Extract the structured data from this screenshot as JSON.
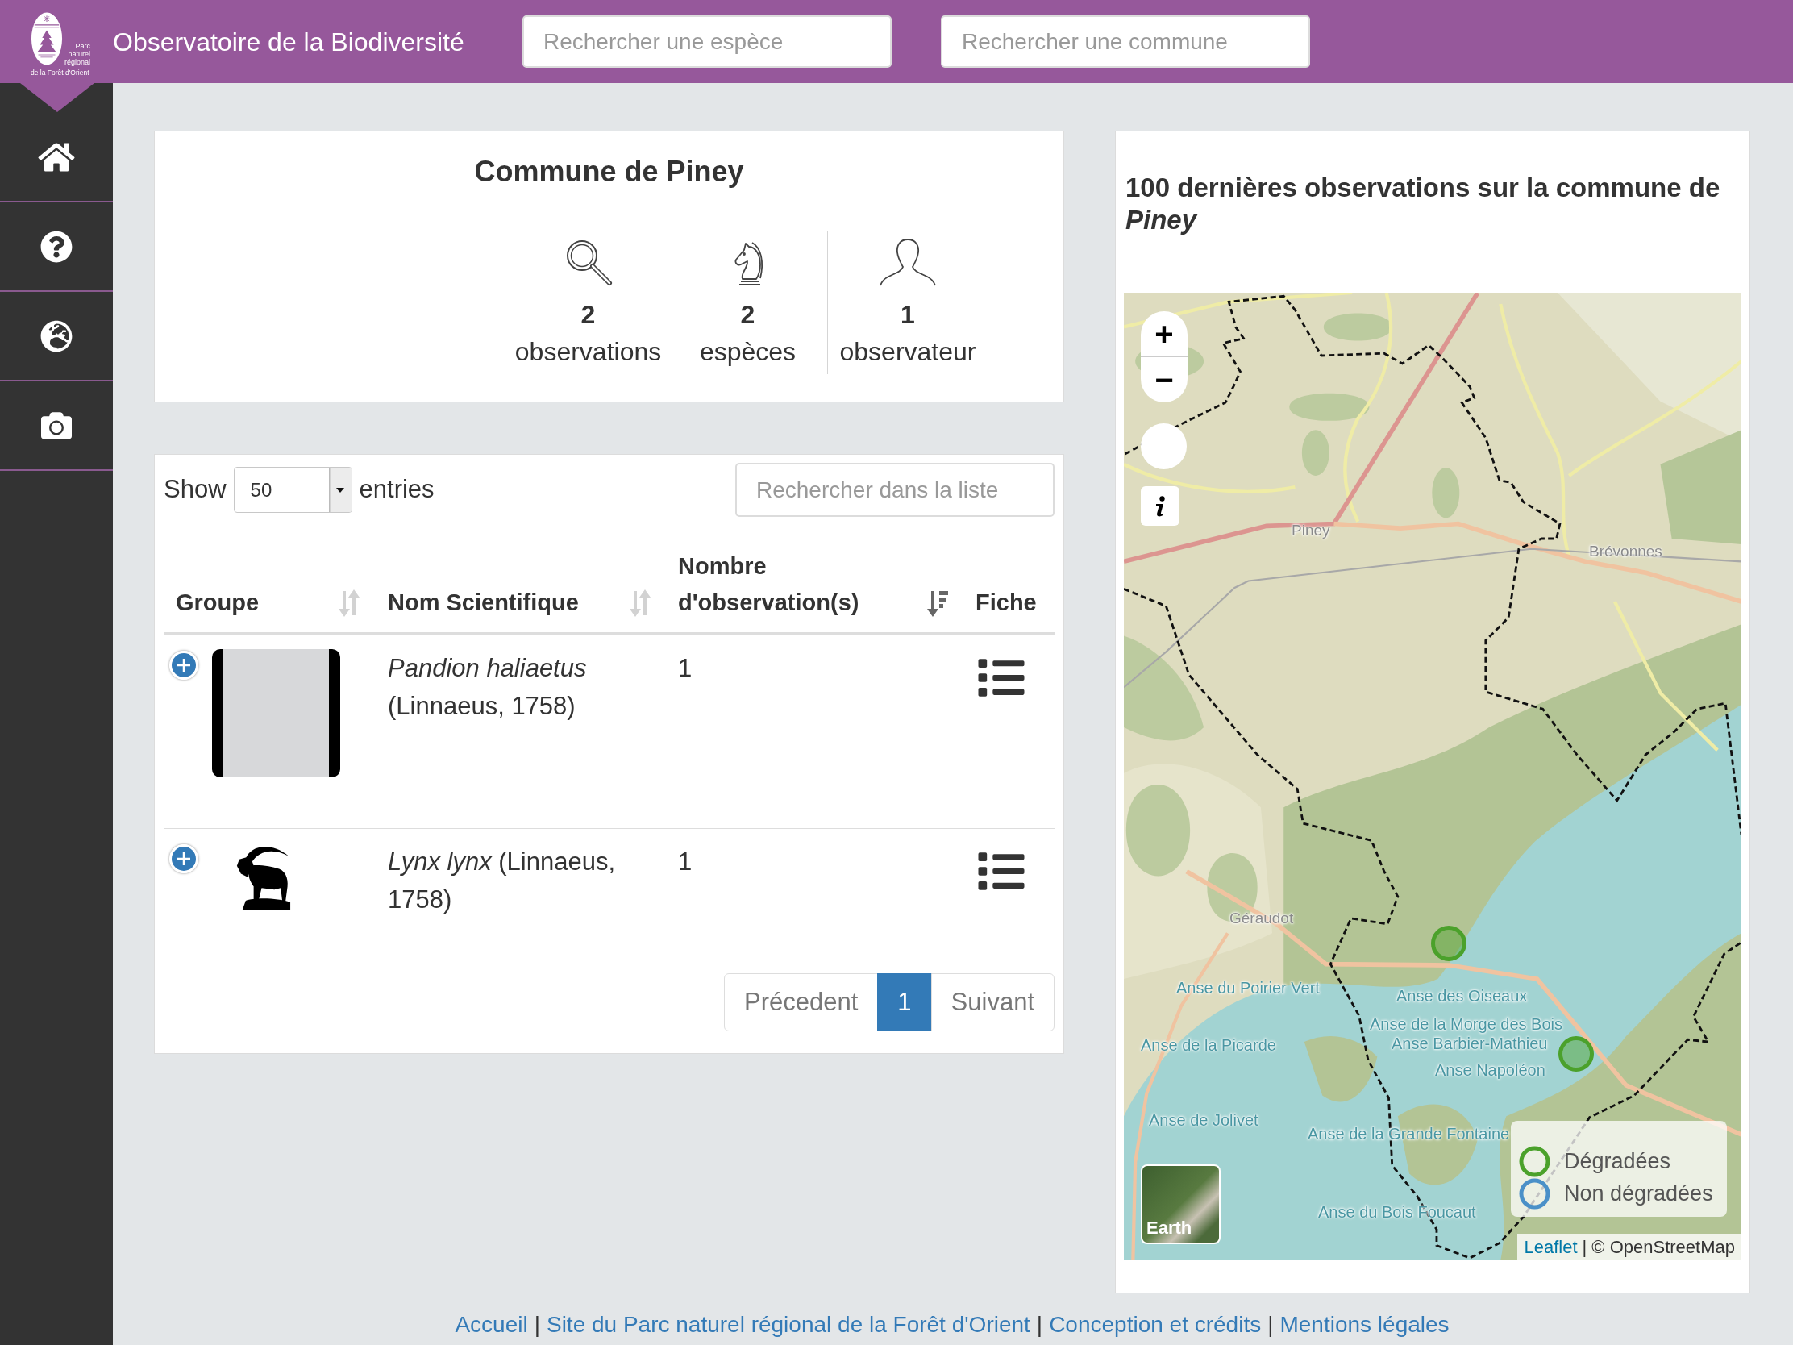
{
  "header": {
    "logo_text": [
      "Parc",
      "naturel",
      "régional",
      "de la Forêt d'Orient"
    ],
    "title": "Observatoire de la Biodiversité",
    "searches": [
      {
        "placeholder": "Rechercher une espèce"
      },
      {
        "placeholder": "Rechercher une commune"
      }
    ]
  },
  "summary": {
    "title": "Commune de Piney",
    "stats": [
      {
        "value": "2",
        "label": "observations"
      },
      {
        "value": "2",
        "label": "espèces"
      },
      {
        "value": "1",
        "label": "observateur"
      }
    ]
  },
  "species_table": {
    "show_label": "Show",
    "page_size": "50",
    "entries_label": "entries",
    "search": {
      "placeholder": "Rechercher dans la liste"
    },
    "columns": [
      {
        "label": "Groupe",
        "kind": "sortable"
      },
      {
        "label": "Nom Scientifique",
        "kind": "sortable"
      },
      {
        "label": "Nombre d'observation(s)",
        "kind": "sorted"
      },
      {
        "label": "Fiche",
        "kind": "plain"
      }
    ],
    "rows": [
      {
        "kind": "photo",
        "name": "*Pandion haliaetus* (Linnaeus, 1758)",
        "count": "1"
      },
      {
        "kind": "silhouette",
        "name": "*Lynx lynx* (Linnaeus, 1758)",
        "count": "1"
      }
    ],
    "pagination": [
      {
        "label": "Précedent",
        "selected": false,
        "disabled": true
      },
      {
        "label": "1",
        "selected": true,
        "disabled": false
      },
      {
        "label": "Suivant",
        "selected": false,
        "disabled": true
      }
    ]
  },
  "map_panel": {
    "title": "100 dernières observations sur la commune de *Piney*",
    "zoom_in": "+",
    "zoom_out": "−",
    "labels": [
      {
        "kind": "town",
        "text": "Piney"
      },
      {
        "kind": "town",
        "text": "Brévonnes"
      },
      {
        "kind": "town",
        "text": "Géraudot"
      },
      {
        "kind": "water",
        "text": "Anse du Poirier Vert"
      },
      {
        "kind": "water",
        "text": "Anse des Oiseaux"
      },
      {
        "kind": "water",
        "text": "Anse de la Morge des Bois"
      },
      {
        "kind": "water",
        "text": "Anse de la Picarde"
      },
      {
        "kind": "water",
        "text": "Anse Barbier-Mathieu"
      },
      {
        "kind": "water",
        "text": "Anse Napoléon"
      },
      {
        "kind": "water",
        "text": "Anse de Jolivet"
      },
      {
        "kind": "water",
        "text": "Anse de la Grande Fontaine"
      },
      {
        "kind": "water",
        "text": "Anse du Bois Foucaut"
      }
    ],
    "markers": [
      {
        "kind": "degraded"
      },
      {
        "kind": "degraded"
      }
    ],
    "layer_button": "Earth",
    "legend": [
      {
        "label": "Dégradées",
        "color": "#4ba12b"
      },
      {
        "label": "Non dégradées",
        "color": "#4a90c8"
      }
    ],
    "attribution": {
      "link": "Leaflet",
      "text": "| © OpenStreetMap"
    }
  },
  "footer": [
    {
      "kind": "link",
      "text": "Accueil"
    },
    {
      "kind": "separator",
      "text": "|"
    },
    {
      "kind": "link",
      "text": "Site du Parc naturel régional de la Forêt d'Orient"
    },
    {
      "kind": "separator",
      "text": "|"
    },
    {
      "kind": "link",
      "text": "Conception et crédits"
    },
    {
      "kind": "separator",
      "text": "|"
    },
    {
      "kind": "link",
      "text": "Mentions légales"
    }
  ]
}
